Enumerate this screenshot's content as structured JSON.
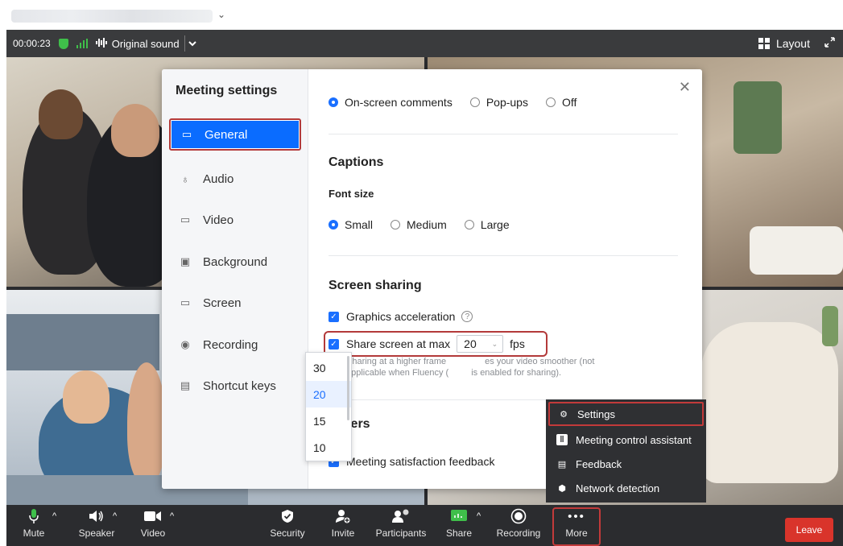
{
  "window": {
    "chevron": "⌄"
  },
  "header": {
    "time": "00:00:23",
    "original_sound": "Original sound",
    "layout_label": "Layout"
  },
  "dialog": {
    "title": "Meeting settings",
    "nav": [
      {
        "label": "General",
        "icon": "chat-icon",
        "active": true
      },
      {
        "label": "Audio",
        "icon": "microphone-icon"
      },
      {
        "label": "Video",
        "icon": "camera-icon"
      },
      {
        "label": "Background",
        "icon": "portrait-icon"
      },
      {
        "label": "Screen",
        "icon": "screen-icon"
      },
      {
        "label": "Recording",
        "icon": "record-icon"
      },
      {
        "label": "Shortcut keys",
        "icon": "keyboard-icon"
      }
    ],
    "comments_options": [
      {
        "label": "On-screen comments",
        "selected": true
      },
      {
        "label": "Pop-ups",
        "selected": false
      },
      {
        "label": "Off",
        "selected": false
      }
    ],
    "captions": {
      "title": "Captions",
      "font_size_label": "Font size",
      "options": [
        {
          "label": "Small",
          "selected": true
        },
        {
          "label": "Medium",
          "selected": false
        },
        {
          "label": "Large",
          "selected": false
        }
      ]
    },
    "screen_sharing": {
      "title": "Screen sharing",
      "graphics_acceleration": "Graphics acceleration",
      "share_max_label": "Share screen at max",
      "fps_value": "20",
      "fps_unit": "fps",
      "hint_left": "Sharing at a higher frame",
      "hint_right": "es your video smoother (not",
      "hint_line2_left": "applicable when Fluency (",
      "hint_line2_right": "is enabled for sharing).",
      "fps_options": [
        "30",
        "20",
        "15",
        "10"
      ],
      "fps_selected": "20"
    },
    "others": {
      "title": "Others",
      "meeting_satisfaction_visible": "Meeting satisfaction feedback"
    }
  },
  "more_menu": {
    "items": [
      {
        "label": "Settings",
        "icon": "gear-icon",
        "highlighted": true
      },
      {
        "label": "Meeting control assistant",
        "icon": "assistant-icon"
      },
      {
        "label": "Feedback",
        "icon": "feedback-icon"
      },
      {
        "label": "Network detection",
        "icon": "network-icon"
      }
    ]
  },
  "toolbar": {
    "mute": "Mute",
    "speaker": "Speaker",
    "video": "Video",
    "security": "Security",
    "invite": "Invite",
    "participants": "Participants",
    "share": "Share",
    "recording": "Recording",
    "more": "More",
    "leave": "Leave"
  },
  "colors": {
    "accent": "#0a6cff",
    "highlight_border": "#b33a3a",
    "leave": "#d9342b",
    "secure": "#3fbf4a"
  }
}
